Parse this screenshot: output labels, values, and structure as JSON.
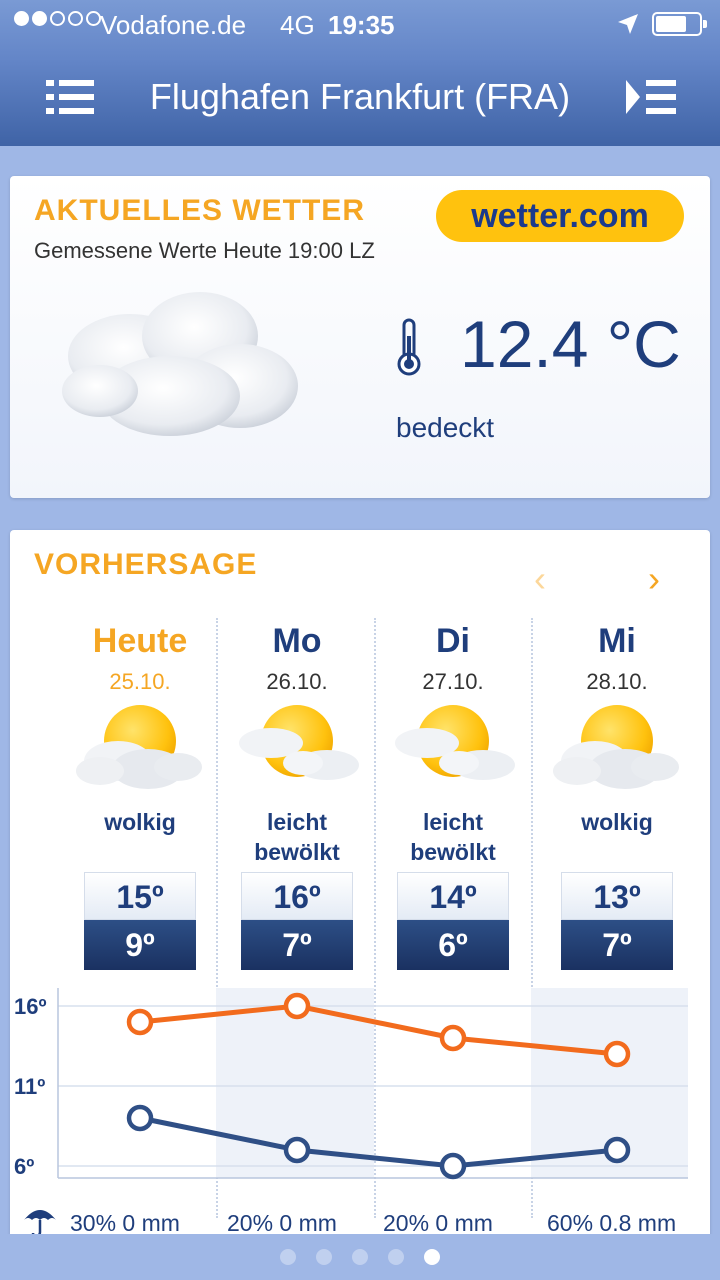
{
  "status_bar": {
    "carrier": "Vodafone.de",
    "network": "4G",
    "time": "19:35",
    "signal_bars_filled": 2,
    "signal_bars_total": 5,
    "battery_level": 0.65
  },
  "header": {
    "title": "Flughafen Frankfurt (FRA)",
    "menu_icon": "hamburger-menu-icon",
    "list_icon": "play-list-icon"
  },
  "current": {
    "section_title": "AKTUELLES WETTER",
    "measured": "Gemessene Werte Heute 19:00 LZ",
    "brand": "wetter.com",
    "temperature": "12.4 °C",
    "condition": "bedeckt",
    "icon": "overcast-cloud-icon"
  },
  "forecast": {
    "section_title": "VORHERSAGE",
    "prev_arrow": "‹",
    "next_arrow": "›",
    "days": [
      {
        "name": "Heute",
        "date": "25.10.",
        "desc": "wolkig",
        "hi": "15º",
        "lo": "9º",
        "icon": "cloudy-sun-icon",
        "precip": "30% 0 mm"
      },
      {
        "name": "Mo",
        "date": "26.10.",
        "desc": "leicht bewölkt",
        "hi": "16º",
        "lo": "7º",
        "icon": "partly-cloudy-icon",
        "precip": "20% 0 mm"
      },
      {
        "name": "Di",
        "date": "27.10.",
        "desc": "leicht bewölkt",
        "hi": "14º",
        "lo": "6º",
        "icon": "partly-cloudy-icon",
        "precip": "20% 0 mm"
      },
      {
        "name": "Mi",
        "date": "28.10.",
        "desc": "wolkig",
        "hi": "13º",
        "lo": "7º",
        "icon": "cloudy-sun-icon",
        "precip": "60% 0.8 mm"
      }
    ],
    "graph": {
      "y_labels": [
        "16º",
        "11º",
        "6º"
      ],
      "y_values": [
        16,
        11,
        6
      ],
      "high_temps": [
        15,
        16,
        14,
        13
      ],
      "low_temps": [
        9,
        7,
        6,
        7
      ],
      "high_color": "#f26b1d",
      "low_color": "#2f4f86"
    }
  },
  "pager": {
    "count": 5,
    "active_index": 4
  }
}
